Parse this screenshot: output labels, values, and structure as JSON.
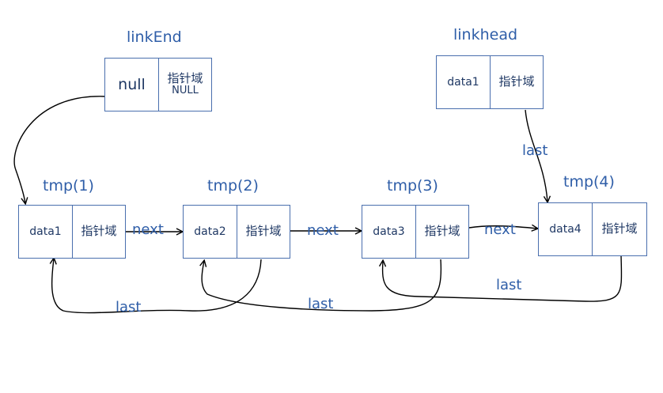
{
  "labels": {
    "link_end": "linkEnd",
    "link_head": "linkhead",
    "tmp1": "tmp(1)",
    "tmp2": "tmp(2)",
    "tmp3": "tmp(3)",
    "tmp4": "tmp(4)"
  },
  "nodes": {
    "link_end": {
      "data": "null",
      "ptr": "指针域",
      "ptr_value": "NULL"
    },
    "link_head": {
      "data": "data1",
      "ptr": "指针域"
    },
    "tmp1": {
      "data": "data1",
      "ptr": "指针域"
    },
    "tmp2": {
      "data": "data2",
      "ptr": "指针域"
    },
    "tmp3": {
      "data": "data3",
      "ptr": "指针域"
    },
    "tmp4": {
      "data": "data4",
      "ptr": "指针域"
    }
  },
  "edges": {
    "next_1_2": "next",
    "next_2_3": "next",
    "next_3_4": "next",
    "last_head_4": "last",
    "last_2_1": "last",
    "last_3_2": "last",
    "last_4_3": "last"
  },
  "colors": {
    "text": "#2f5ea8",
    "border": "#4a6fae",
    "line": "#000000"
  }
}
